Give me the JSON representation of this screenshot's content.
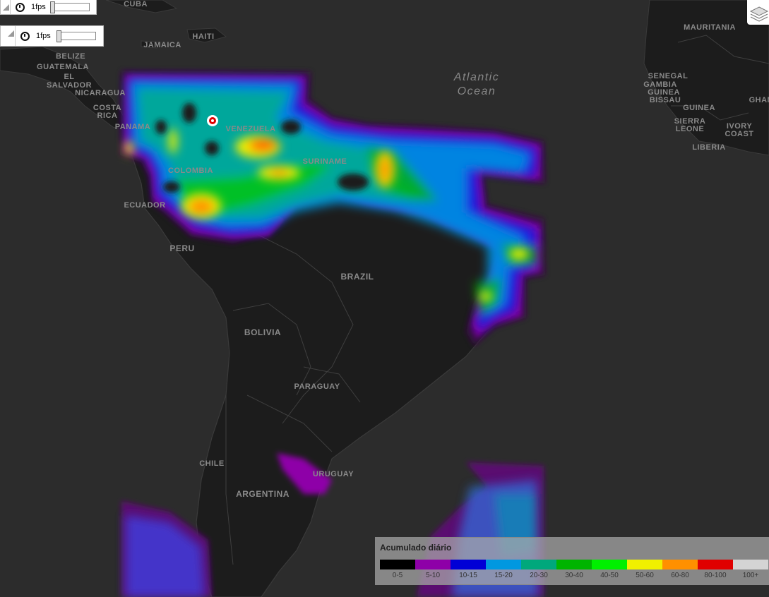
{
  "controls": [
    {
      "fps_label": "1fps"
    },
    {
      "fps_label": "1fps"
    }
  ],
  "ocean": {
    "line1": "Atlantic",
    "line2": "Ocean"
  },
  "countries": [
    "CUBA",
    "HAITI",
    "JAMAICA",
    "BELIZE",
    "GUATEMALA",
    "EL",
    "SALVADOR",
    "NICARAGUA",
    "COSTA",
    "RICA",
    "PANAMA",
    "VENEZUELA",
    "COLOMBIA",
    "ECUADOR",
    "SURINAME",
    "PERU",
    "BRAZIL",
    "BOLIVIA",
    "PARAGUAY",
    "CHILE",
    "ARGENTINA",
    "URUGUAY",
    "MAURITANIA",
    "SENEGAL",
    "GAMBIA",
    "GUINEA",
    "BISSAU",
    "GUINEA",
    "SIERRA",
    "LEONE",
    "IVORY",
    "COAST",
    "LIBERIA",
    "GHANA"
  ],
  "legend": {
    "title": "Acumulado diário",
    "items": [
      {
        "label": "0-5",
        "color": "#000000"
      },
      {
        "label": "5-10",
        "color": "#8e00a8"
      },
      {
        "label": "10-15",
        "color": "#0000d6"
      },
      {
        "label": "15-20",
        "color": "#0098e0"
      },
      {
        "label": "20-30",
        "color": "#00a87c"
      },
      {
        "label": "30-40",
        "color": "#00b400"
      },
      {
        "label": "40-50",
        "color": "#00f000"
      },
      {
        "label": "50-60",
        "color": "#f0f000"
      },
      {
        "label": "60-80",
        "color": "#ff9000"
      },
      {
        "label": "80-100",
        "color": "#e00000"
      },
      {
        "label": "100+",
        "color": "#d4d4d4"
      }
    ]
  }
}
